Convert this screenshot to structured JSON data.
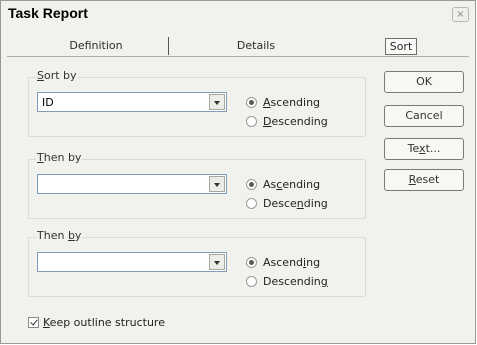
{
  "window": {
    "title": "Task Report",
    "close_glyph": "×"
  },
  "tabs": [
    {
      "label": "Definition"
    },
    {
      "label": "Details"
    },
    {
      "label": "Sort",
      "selected": true
    }
  ],
  "sort_groups": [
    {
      "label_pre": "",
      "label_key": "S",
      "label_post": "ort by",
      "value": "ID",
      "asc_pre": "",
      "asc_key": "A",
      "asc_post": "scending",
      "asc_selected": true,
      "desc_pre": "",
      "desc_key": "D",
      "desc_post": "escending"
    },
    {
      "label_pre": "",
      "label_key": "T",
      "label_post": "hen by",
      "value": "",
      "asc_pre": "As",
      "asc_key": "c",
      "asc_post": "ending",
      "asc_selected": true,
      "desc_pre": "Desce",
      "desc_key": "n",
      "desc_post": "ding"
    },
    {
      "label_pre": "Then ",
      "label_key": "b",
      "label_post": "y",
      "value": "",
      "asc_pre": "Ascend",
      "asc_key": "i",
      "asc_post": "ng",
      "asc_selected": true,
      "desc_pre": "Descendin",
      "desc_key": "g",
      "desc_post": ""
    }
  ],
  "buttons": {
    "ok": {
      "label": "OK"
    },
    "cancel": {
      "label": "Cancel"
    },
    "text": {
      "pre": "Te",
      "key": "x",
      "post": "t..."
    },
    "reset": {
      "pre": "",
      "key": "R",
      "post": "eset"
    }
  },
  "keep_outline": {
    "pre": "",
    "key": "K",
    "post": "eep outline structure",
    "checked": true
  }
}
